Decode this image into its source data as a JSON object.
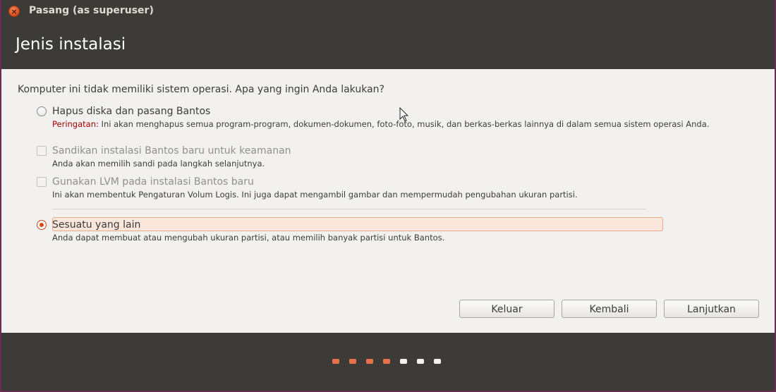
{
  "window": {
    "title": "Pasang (as superuser)"
  },
  "page": {
    "title": "Jenis instalasi"
  },
  "question": "Komputer ini tidak memiliki sistem operasi. Apa yang ingin Anda lakukan?",
  "options": {
    "erase": {
      "label": "Hapus diska dan pasang Bantos",
      "warning_prefix": "Peringatan:",
      "desc": "Ini akan menghapus semua program-program, dokumen-dokumen, foto-foto, musik, dan berkas-berkas lainnya di dalam semua sistem operasi Anda.",
      "selected": false
    },
    "encrypt": {
      "label": "Sandikan instalasi Bantos baru untuk keamanan",
      "desc": "Anda akan memilih sandi pada langkah selanjutnya.",
      "enabled": false
    },
    "lvm": {
      "label": "Gunakan LVM pada instalasi Bantos baru",
      "desc": "Ini akan membentuk Pengaturan Volum Logis. Ini juga dapat mengambil gambar dan mempermudah pengubahan ukuran partisi.",
      "enabled": false
    },
    "other": {
      "label": "Sesuatu yang lain",
      "desc": "Anda dapat membuat atau mengubah ukuran partisi, atau memilih banyak partisi untuk Bantos.",
      "selected": true
    }
  },
  "buttons": {
    "quit": "Keluar",
    "back": "Kembali",
    "continue": "Lanjutkan"
  },
  "progress": {
    "total_steps": 7,
    "completed_steps": 4
  },
  "colors": {
    "accent": "#dd4814",
    "header": "#3c3b37",
    "background": "#f2f1f0",
    "progress_active": "#e8734a"
  },
  "icons": {
    "close": "close-icon",
    "cursor": "mouse-pointer-icon"
  }
}
